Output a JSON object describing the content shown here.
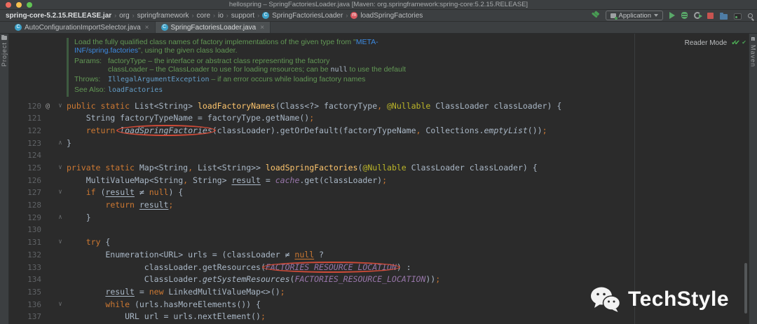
{
  "window": {
    "title": "hellospring – SpringFactoriesLoader.java [Maven: org.springframework:spring-core:5.2.15.RELEASE]"
  },
  "breadcrumbs": {
    "separator": "›",
    "items": [
      {
        "label": "spring-core-5.2.15.RELEASE.jar"
      },
      {
        "label": "org"
      },
      {
        "label": "springframework"
      },
      {
        "label": "core"
      },
      {
        "label": "io"
      },
      {
        "label": "support"
      },
      {
        "label": "SpringFactoriesLoader",
        "icon": "class",
        "icon_letter": "C"
      },
      {
        "label": "loadSpringFactories",
        "icon": "method",
        "icon_letter": "m"
      }
    ]
  },
  "toolbar": {
    "run_config": "Application"
  },
  "tabs": {
    "close_label": "×",
    "class_icon_letter": "C",
    "items": [
      {
        "label": "AutoConfigurationImportSelector.java",
        "active": false
      },
      {
        "label": "SpringFactoriesLoader.java",
        "active": true
      }
    ]
  },
  "tool_windows": {
    "left": "Project",
    "right": "Maven",
    "maven_icon": "m"
  },
  "editor": {
    "reader_mode_label": "Reader Mode",
    "reader_mode_check": "✔✔",
    "inspection_ok": "✔",
    "javadoc": {
      "intro_1": "Load the fully qualified class names of factory implementations of the given type from \"",
      "intro_link": "META-INF/spring.factories",
      "intro_2": "\", using the given class loader.",
      "params_label": "Params:",
      "param1_name": "factoryType",
      "param1_text": " – the interface or abstract class representing the factory",
      "param2_name": "classLoader",
      "param2_text_1": " – the ClassLoader to use for loading resources; can be ",
      "param2_code": "null",
      "param2_text_2": " to use the default",
      "throws_label": "Throws:",
      "throws_code": "IllegalArgumentException",
      "throws_text": " – if an error occurs while loading factory names",
      "seealso_label": "See Also:",
      "seealso_link": "loadFactories"
    },
    "code": {
      "lines": [
        {
          "n": "120",
          "a": "@",
          "f": "down",
          "s": [
            [
              "public static ",
              "kw"
            ],
            [
              "List<String> ",
              "pl"
            ],
            [
              "loadFactoryNames",
              "md"
            ],
            [
              "(Class<?> factoryType",
              "pl"
            ],
            [
              ", ",
              "pu"
            ],
            [
              "@Nullable",
              "an"
            ],
            [
              " ClassLoader classLoader) {",
              "pl"
            ]
          ]
        },
        {
          "n": "121",
          "s": [
            [
              "    String factoryTypeName = factoryType.getName()",
              "pl"
            ],
            [
              ";",
              "pu"
            ]
          ]
        },
        {
          "n": "122",
          "s": [
            [
              "    ",
              "pl"
            ],
            [
              "return ",
              "kw"
            ],
            [
              "loadSpringFactories",
              "it",
              1
            ],
            [
              "(classLoader).getOrDefault(factoryTypeName",
              "pl"
            ],
            [
              ", ",
              "pu"
            ],
            [
              "Collections.",
              "pl"
            ],
            [
              "emptyList",
              "it"
            ],
            [
              "())",
              "pl"
            ],
            [
              ";",
              "pu"
            ]
          ]
        },
        {
          "n": "123",
          "f": "up",
          "s": [
            [
              "}",
              "pl"
            ]
          ]
        },
        {
          "n": "124",
          "s": []
        },
        {
          "n": "125",
          "f": "down",
          "s": [
            [
              "private static ",
              "kw"
            ],
            [
              "Map<String",
              "pl"
            ],
            [
              ", ",
              "pu"
            ],
            [
              "List<String>> ",
              "pl"
            ],
            [
              "loadSpringFactories",
              "md"
            ],
            [
              "(",
              "pl"
            ],
            [
              "@Nullable",
              "an"
            ],
            [
              " ClassLoader classLoader) {",
              "pl"
            ]
          ]
        },
        {
          "n": "126",
          "s": [
            [
              "    MultiValueMap<String",
              "pl"
            ],
            [
              ", ",
              "pu"
            ],
            [
              "String> ",
              "pl"
            ],
            [
              "result",
              "uv"
            ],
            [
              " = ",
              "pl"
            ],
            [
              "cache",
              "fi"
            ],
            [
              ".get(classLoader)",
              "pl"
            ],
            [
              ";",
              "pu"
            ]
          ]
        },
        {
          "n": "127",
          "f": "down",
          "s": [
            [
              "    ",
              "pl"
            ],
            [
              "if",
              "kw"
            ],
            [
              " (",
              "pl"
            ],
            [
              "result",
              "uv"
            ],
            [
              " ≠ ",
              "pl"
            ],
            [
              "null",
              "kw"
            ],
            [
              ") {",
              "pl"
            ]
          ]
        },
        {
          "n": "128",
          "s": [
            [
              "        ",
              "pl"
            ],
            [
              "return ",
              "kw"
            ],
            [
              "result",
              "uv"
            ],
            [
              ";",
              "pu"
            ]
          ]
        },
        {
          "n": "129",
          "f": "up",
          "s": [
            [
              "    }",
              "pl"
            ]
          ]
        },
        {
          "n": "130",
          "s": []
        },
        {
          "n": "131",
          "f": "down",
          "s": [
            [
              "    ",
              "pl"
            ],
            [
              "try",
              "kw"
            ],
            [
              " {",
              "pl"
            ]
          ]
        },
        {
          "n": "132",
          "s": [
            [
              "        Enumeration<URL> urls = (classLoader ≠ ",
              "pl"
            ],
            [
              "null",
              "kwu"
            ],
            [
              " ?",
              "pl"
            ]
          ]
        },
        {
          "n": "133",
          "s": [
            [
              "                classLoader.getResources(",
              "pl"
            ],
            [
              "FACTORIES_RESOURCE_LOCATION",
              "fi",
              1
            ],
            [
              ") :",
              "pl"
            ]
          ]
        },
        {
          "n": "134",
          "s": [
            [
              "                ClassLoader.",
              "pl"
            ],
            [
              "getSystemResources",
              "it"
            ],
            [
              "(",
              "pl"
            ],
            [
              "FACTORIES_RESOURCE_LOCATION",
              "fi"
            ],
            [
              "))",
              "pl"
            ],
            [
              ";",
              "pu"
            ]
          ]
        },
        {
          "n": "135",
          "s": [
            [
              "        ",
              "pl"
            ],
            [
              "result",
              "uv"
            ],
            [
              " = ",
              "pl"
            ],
            [
              "new ",
              "kw"
            ],
            [
              "LinkedMultiValueMap<>()",
              "pl"
            ],
            [
              ";",
              "pu"
            ]
          ]
        },
        {
          "n": "136",
          "f": "down",
          "s": [
            [
              "        ",
              "pl"
            ],
            [
              "while",
              "kw"
            ],
            [
              " (urls.hasMoreElements()) {",
              "pl"
            ]
          ]
        },
        {
          "n": "137",
          "s": [
            [
              "            URL url = urls.nextElement()",
              "pl"
            ],
            [
              ";",
              "pu"
            ]
          ]
        }
      ]
    }
  },
  "watermark": {
    "text": "TechStyle"
  }
}
